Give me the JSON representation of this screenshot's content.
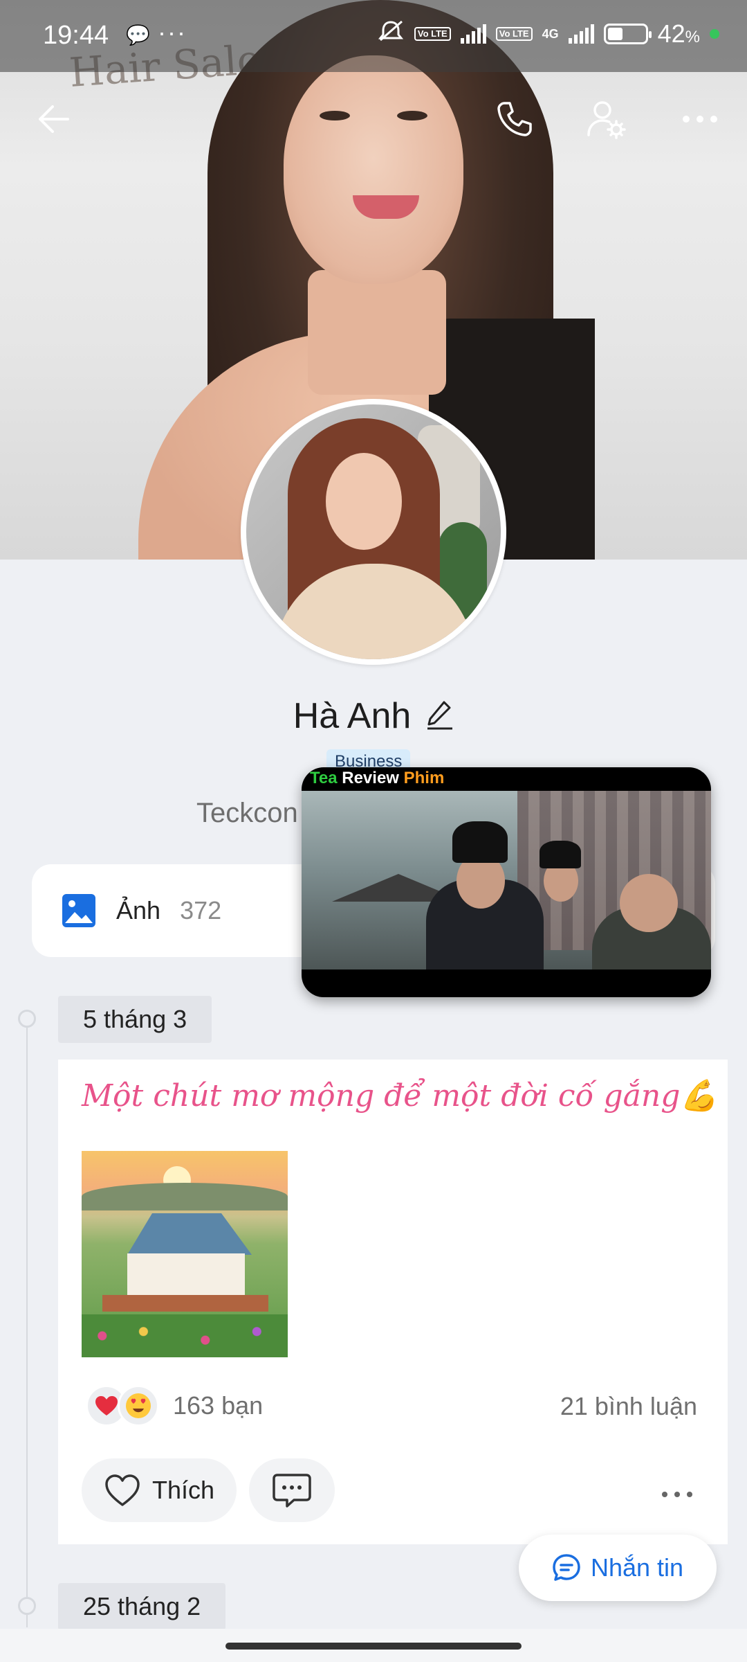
{
  "status_bar": {
    "time": "19:44",
    "network_type": "4G",
    "volte_1": "Vo LTE",
    "volte_2": "Vo LTE",
    "battery_percent": "42",
    "battery_level": 0.42,
    "battery_suffix": "%"
  },
  "cover": {
    "wall_text": "Hair Salon"
  },
  "header": {
    "back_icon": "arrow-left-icon",
    "call_icon": "phone-icon",
    "settings_icon": "user-gear-icon",
    "more_icon": "more-horizontal-icon"
  },
  "profile": {
    "name": "Hà Anh",
    "badge": "Business",
    "bio_partial": "Teckcon"
  },
  "photos": {
    "label": "Ảnh",
    "count": "372"
  },
  "video_overlay": {
    "title_part1": "Tea",
    "title_part2": "Review",
    "title_part3": "Phim",
    "color1": "#2ecc40",
    "color2": "#ffffff",
    "color3": "#ff9d1e"
  },
  "timeline": {
    "entries": [
      {
        "date": "5 tháng 3",
        "caption": "Một chút mơ mộng để một đời cố gắng💪",
        "reactions": [
          "heart",
          "heart-eyes"
        ],
        "friends_reacted": "163 bạn",
        "comments": "21 bình luận",
        "like_label": "Thích"
      },
      {
        "date": "25 tháng 2"
      }
    ]
  },
  "fab": {
    "label": "Nhắn tin"
  },
  "colors": {
    "accent": "#1a6ee0",
    "caption_pink": "#e8538a",
    "badge_bg": "#d8ecfb",
    "online_dot": "#37c55c"
  }
}
